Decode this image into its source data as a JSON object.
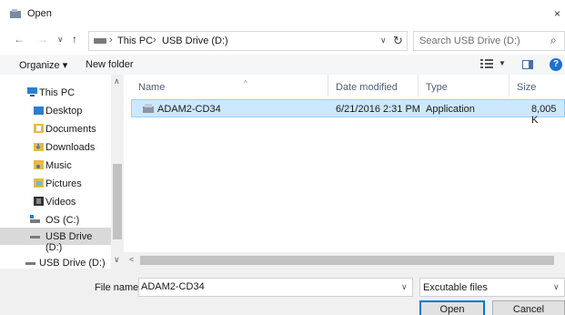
{
  "window": {
    "title": "Open",
    "close_glyph": "×"
  },
  "address": {
    "crumbs": [
      "This PC",
      "USB Drive (D:)"
    ],
    "search_placeholder": "Search USB Drive (D:)"
  },
  "toolbar": {
    "organize": "Organize ▾",
    "new_folder": "New folder"
  },
  "nav": {
    "items": [
      {
        "label": "This PC",
        "icon": "computer-icon"
      },
      {
        "label": "Desktop",
        "icon": "desktop-folder-icon"
      },
      {
        "label": "Documents",
        "icon": "documents-folder-icon"
      },
      {
        "label": "Downloads",
        "icon": "downloads-folder-icon"
      },
      {
        "label": "Music",
        "icon": "music-folder-icon"
      },
      {
        "label": "Pictures",
        "icon": "pictures-folder-icon"
      },
      {
        "label": "Videos",
        "icon": "videos-folder-icon"
      },
      {
        "label": "OS (C:)",
        "icon": "os-drive-icon"
      },
      {
        "label": "USB Drive (D:)",
        "icon": "usb-drive-icon",
        "selected": true
      }
    ],
    "bottom_item": {
      "label": "USB Drive (D:)",
      "icon": "usb-drive-icon"
    }
  },
  "columns": {
    "name": "Name",
    "date": "Date modified",
    "type": "Type",
    "size": "Size"
  },
  "files": [
    {
      "name": "ADAM2-CD34",
      "date": "6/21/2016 2:31 PM",
      "type": "Application",
      "size": "8,005 K",
      "icon": "application-icon"
    }
  ],
  "bottom": {
    "file_name_label": "File name:",
    "file_name_value": "ADAM2-CD34",
    "filter": "Excutable files",
    "open": "Open",
    "cancel": "Cancel"
  },
  "colors": {
    "selection": "#cce8ff",
    "accent": "#0078d7",
    "header_text": "#4c607a"
  }
}
